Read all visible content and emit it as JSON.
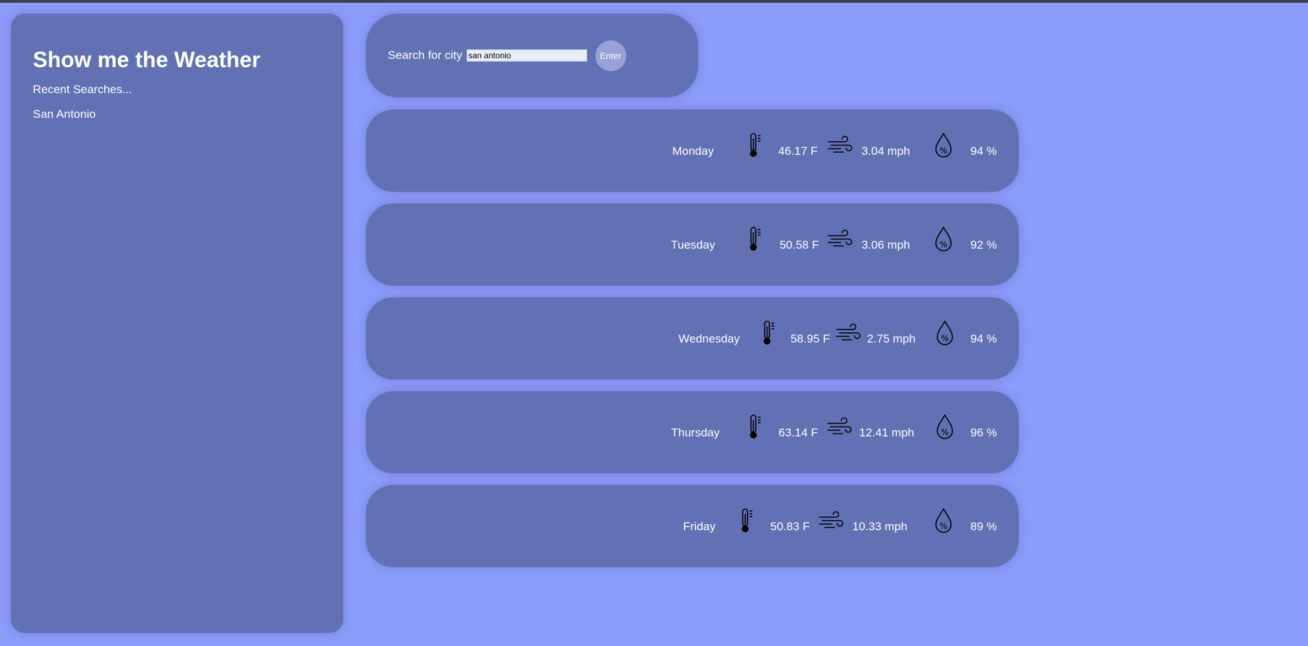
{
  "app": {
    "title": "Show me the Weather"
  },
  "sidebar": {
    "recent_label": "Recent Searches...",
    "recent_items": [
      "San Antonio"
    ]
  },
  "search": {
    "label": "Search for city",
    "value": "san antonio",
    "button_label": "Enter"
  },
  "forecast": [
    {
      "day": "Monday",
      "temp": "46.17 F",
      "wind": "3.04 mph",
      "humidity": "94 %"
    },
    {
      "day": "Tuesday",
      "temp": "50.58 F",
      "wind": "3.06 mph",
      "humidity": "92 %"
    },
    {
      "day": "Wednesday",
      "temp": "58.95 F",
      "wind": "2.75 mph",
      "humidity": "94 %"
    },
    {
      "day": "Thursday",
      "temp": "63.14 F",
      "wind": "12.41 mph",
      "humidity": "96 %"
    },
    {
      "day": "Friday",
      "temp": "50.83 F",
      "wind": "10.33 mph",
      "humidity": "89 %"
    }
  ],
  "icons": {
    "temperature": "thermometer-icon",
    "wind": "wind-icon",
    "humidity": "humidity-drop-icon"
  },
  "colors": {
    "page_background": "#8c9cfb",
    "card_background": "#6270b4",
    "button_background": "#98a2d8",
    "text": "#ffffff"
  }
}
